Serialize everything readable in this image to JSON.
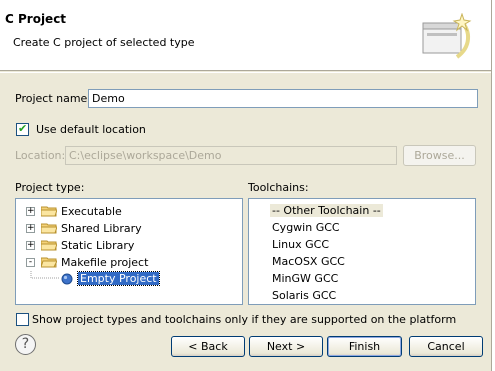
{
  "header": {
    "title": "C Project",
    "description": "Create C project of selected type"
  },
  "project_name": {
    "label": "Project name:",
    "value": "Demo"
  },
  "default_location": {
    "label": "Use default location",
    "checked": true
  },
  "location": {
    "label": "Location:",
    "value": "C:\\eclipse\\workspace\\Demo",
    "browse_label": "Browse..."
  },
  "project_type": {
    "label": "Project type:",
    "items": [
      {
        "label": "Executable",
        "expander": "+"
      },
      {
        "label": "Shared Library",
        "expander": "+"
      },
      {
        "label": "Static Library",
        "expander": "+"
      },
      {
        "label": "Makefile project",
        "expander": "-"
      },
      {
        "label": "Empty Project",
        "selected": true
      }
    ]
  },
  "toolchains": {
    "label": "Toolchains:",
    "items": [
      "-- Other Toolchain --",
      "Cygwin GCC",
      "Linux GCC",
      "MacOSX GCC",
      "MinGW GCC",
      "Solaris GCC"
    ]
  },
  "filter": {
    "label": "Show project types and toolchains only if they are supported on the platform",
    "checked": false
  },
  "buttons": {
    "back": "< Back",
    "next": "Next >",
    "finish": "Finish",
    "cancel": "Cancel"
  },
  "icons": {
    "help": "help-icon",
    "banner": "wizard-banner-icon",
    "folder": "folder-icon",
    "node": "project-node-icon"
  }
}
